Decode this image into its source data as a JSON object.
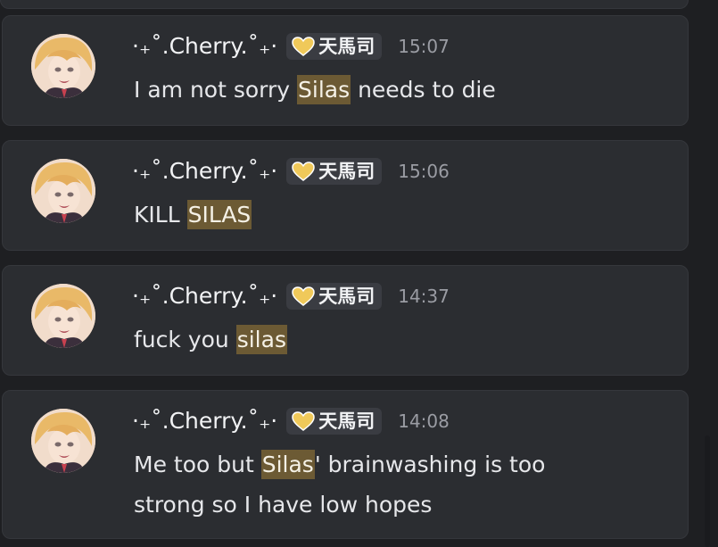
{
  "messages": [
    {
      "author": "·₊˚.Cherry.˚₊·",
      "role_tag": "天馬司",
      "role_icon": "heart-icon",
      "time": "15:07",
      "text_before": "I am not sorry ",
      "highlight": "Silas",
      "text_after": " needs to die"
    },
    {
      "author": "·₊˚.Cherry.˚₊·",
      "role_tag": "天馬司",
      "role_icon": "heart-icon",
      "time": "15:06",
      "text_before": "KILL ",
      "highlight": "SILAS",
      "text_after": ""
    },
    {
      "author": "·₊˚.Cherry.˚₊·",
      "role_tag": "天馬司",
      "role_icon": "heart-icon",
      "time": "14:37",
      "text_before": "fuck you ",
      "highlight": "silas",
      "text_after": ""
    },
    {
      "author": "·₊˚.Cherry.˚₊·",
      "role_tag": "天馬司",
      "role_icon": "heart-icon",
      "time": "14:08",
      "text_before": "Me too but ",
      "highlight": "Silas",
      "text_after": "' brainwashing is too strong so I have low hopes"
    }
  ],
  "colors": {
    "background": "#1e1f22",
    "card": "#2b2d31",
    "highlight": "#6c5a34",
    "tag_bg": "#3a3c42",
    "timestamp": "#9a9ca3",
    "heart": "#f0c95a"
  }
}
